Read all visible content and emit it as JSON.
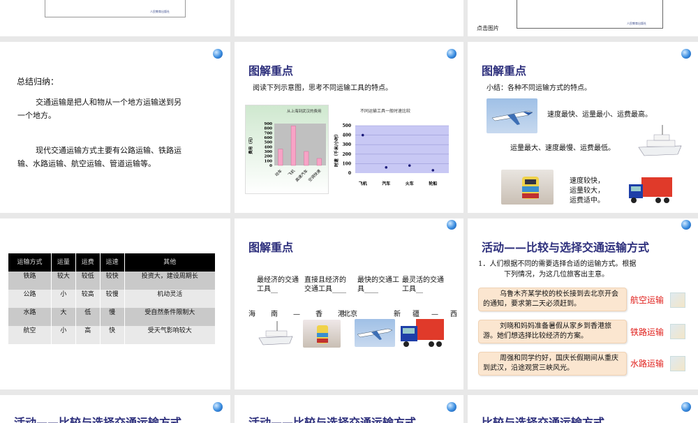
{
  "slides": {
    "s1": {
      "logo_text": "人民教育出版社"
    },
    "s3": {
      "caption": "点击图片",
      "logo_text": "人民教育出版社"
    },
    "s4": {
      "heading": "总结归纳：",
      "para1": "交通运输是把人和物从一个地方运输送到另",
      "para1b": "一个地方。",
      "para2": "现代交通运输方式主要有公路运输、铁路运",
      "para2b": "输、水路运输、航空运输、管道运输等。"
    },
    "s5": {
      "title": "图解重点",
      "text": "阅读下列示意图，思考不同运输工具的特点。"
    },
    "s6": {
      "title": "图解重点",
      "text": "小结：各种不同运输方式的特点。",
      "air": "速度最快、运量最小、运费最高。",
      "water": "运量最大、速度最慢、运费最低。",
      "land": [
        "速度较快，",
        "运量较大，",
        "运费适中。"
      ]
    },
    "s7": {
      "headers": [
        "运输方式",
        "运量",
        "运费",
        "运速",
        "其他"
      ],
      "rows": [
        [
          "铁路",
          "较大",
          "较低",
          "较快",
          "投资大，建设周期长"
        ],
        [
          "公路",
          "小",
          "较高",
          "较慢",
          "机动灵活"
        ],
        [
          "水路",
          "大",
          "低",
          "慢",
          "受自然条件限制大"
        ],
        [
          "航空",
          "小",
          "高",
          "快",
          "受天气影响较大"
        ]
      ]
    },
    "s8": {
      "title": "图解重点",
      "q": [
        "最经济的交通工具__",
        "直接且经济的交通工具____",
        "最快的交通工具____",
        "最灵活的交通工具__"
      ],
      "routes": [
        "海南—香港",
        "北京",
        "新疆—西藏"
      ]
    },
    "s9": {
      "title": "活动——比较与选择交通运输方式",
      "intro1": "1．人们根据不同的需要选择合适的运输方式。根据",
      "intro2": "下列情况，为这几位旅客出主意。",
      "cases": [
        {
          "text": "乌鲁木齐某学校的校长接到去北京开会的通知，要求第二天必须赶到。",
          "answer": "航空运输"
        },
        {
          "text": "刘晓和妈妈准备暑假从家乡到香港旅游。她们想选择比较经济的方案。",
          "answer": "铁路运输"
        },
        {
          "text": "周强和同学约好，国庆长假期间从重庆到武汉，沿途观赏三峡风光。",
          "answer": "水路运输"
        }
      ]
    },
    "s10": {
      "title": "活动——比较与选择交通运输方式"
    },
    "s11": {
      "title": "活动——比较与选择交通运输方式"
    },
    "s12": {
      "title": "比较与选择交通运输方式"
    }
  },
  "chart_data": [
    {
      "type": "bar",
      "title": "从上海到武汉的费用",
      "ylabel": "费用（元）",
      "categories": [
        "动车",
        "飞机",
        "高速汽车",
        "空调快速"
      ],
      "values": [
        350,
        850,
        300,
        150
      ],
      "ylim": [
        0,
        900
      ],
      "yticks": [
        0,
        100,
        200,
        300,
        400,
        500,
        600,
        700,
        800,
        900
      ],
      "color": "#f7a3c6"
    },
    {
      "type": "scatter",
      "title": "不同运输工具一般时速比较",
      "ylabel": "时速（千米/小时）",
      "categories": [
        "飞机",
        "汽车",
        "火车",
        "轮船"
      ],
      "values": [
        400,
        60,
        80,
        30
      ],
      "ylim": [
        0,
        500
      ],
      "yticks": [
        0,
        100,
        200,
        300,
        400,
        500
      ],
      "color": "#1a1a7a"
    }
  ]
}
